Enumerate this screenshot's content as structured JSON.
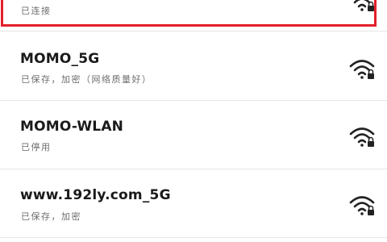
{
  "colors": {
    "highlight": "#e21f2b",
    "text_primary": "#1a1a1a",
    "text_secondary": "#6e6e6e",
    "divider": "#e6e6e6",
    "icon": "#222222"
  },
  "networks": [
    {
      "name": "",
      "status": "已连接",
      "icon": "wifi-locked-icon",
      "highlighted": true
    },
    {
      "name": "MOMO_5G",
      "status": "已保存，加密（网络质量好）",
      "icon": "wifi-locked-icon",
      "highlighted": false
    },
    {
      "name": "MOMO-WLAN",
      "status": "已停用",
      "icon": "wifi-locked-icon",
      "highlighted": false
    },
    {
      "name": "www.192ly.com_5G",
      "status": "已保存，加密",
      "icon": "wifi-locked-icon",
      "highlighted": false
    }
  ]
}
